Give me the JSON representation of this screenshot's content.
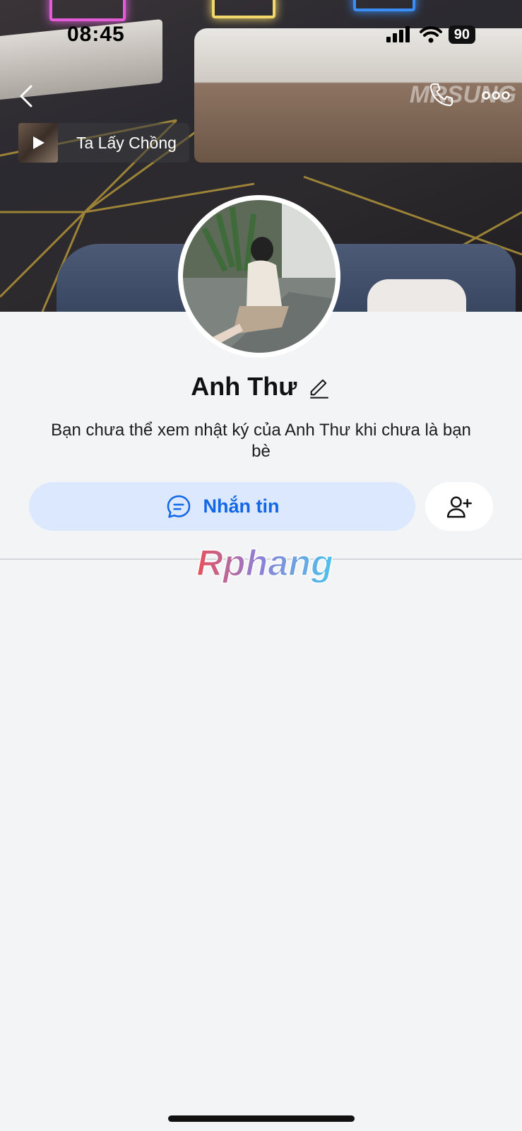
{
  "status_bar": {
    "time": "08:45",
    "battery": "90"
  },
  "nav": {
    "back_icon": "chevron-left-icon",
    "call_icon": "phone-icon",
    "more_icon": "more-dots-icon"
  },
  "music": {
    "title": "Ta Lấy Chồng",
    "play_icon": "play-icon"
  },
  "cover": {
    "sign_text": "MRSUNG"
  },
  "profile": {
    "name": "Anh Thư",
    "edit_icon": "pencil-icon",
    "description": "Bạn chưa thể xem nhật ký của Anh Thư khi chưa là bạn bè"
  },
  "actions": {
    "message_label": "Nhắn tin",
    "message_icon": "chat-bubble-icon",
    "add_friend_icon": "add-friend-icon"
  },
  "watermark": {
    "text": "Rphang"
  },
  "colors": {
    "accent": "#1167e8",
    "message_bg": "#dbe8fd",
    "page_bg": "#f3f4f6"
  }
}
